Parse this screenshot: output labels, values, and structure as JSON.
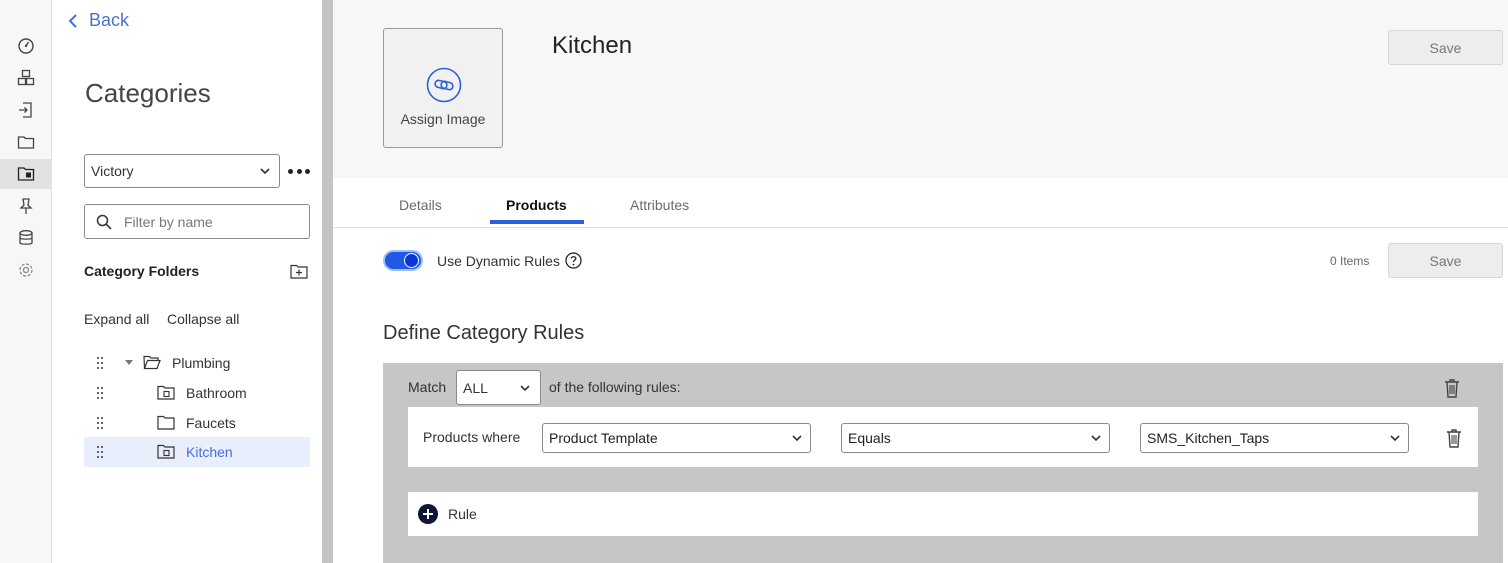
{
  "rail": {
    "items": [
      {
        "icon": "dashboard-icon"
      },
      {
        "icon": "products-icon"
      },
      {
        "icon": "import-icon"
      },
      {
        "icon": "folder-icon"
      },
      {
        "icon": "categories-icon",
        "active": true
      },
      {
        "icon": "pin-icon"
      },
      {
        "icon": "database-icon"
      },
      {
        "icon": "settings-icon"
      }
    ]
  },
  "sidebar": {
    "back_label": "Back",
    "title": "Categories",
    "catalog_value": "Victory",
    "filter_placeholder": "Filter by name",
    "folders_heading": "Category Folders",
    "expand_all": "Expand all",
    "collapse_all": "Collapse all",
    "tree": [
      {
        "label": "Plumbing",
        "level": 0,
        "expanded": true
      },
      {
        "label": "Bathroom",
        "level": 1
      },
      {
        "label": "Faucets",
        "level": 1
      },
      {
        "label": "Kitchen",
        "level": 1,
        "selected": true
      }
    ]
  },
  "header": {
    "assign_image_label": "Assign Image",
    "title": "Kitchen",
    "save_label": "Save"
  },
  "tabs": [
    {
      "label": "Details"
    },
    {
      "label": "Products",
      "active": true
    },
    {
      "label": "Attributes"
    }
  ],
  "products": {
    "dynamic_rules_label": "Use Dynamic Rules",
    "dynamic_rules_enabled": true,
    "items_count": "0 Items",
    "save_label": "Save"
  },
  "rules": {
    "section_title": "Define Category Rules",
    "match_label": "Match",
    "match_value": "ALL",
    "match_suffix": "of the following rules:",
    "rule": {
      "prefix": "Products where",
      "field": "Product Template",
      "operator": "Equals",
      "value": "SMS_Kitchen_Taps"
    },
    "add_rule_label": "Rule"
  },
  "colors": {
    "accent": "#2c5fde",
    "link": "#4a6fd6",
    "toggle_on": "#2158e8",
    "panel_bg": "#c6c6c6"
  }
}
